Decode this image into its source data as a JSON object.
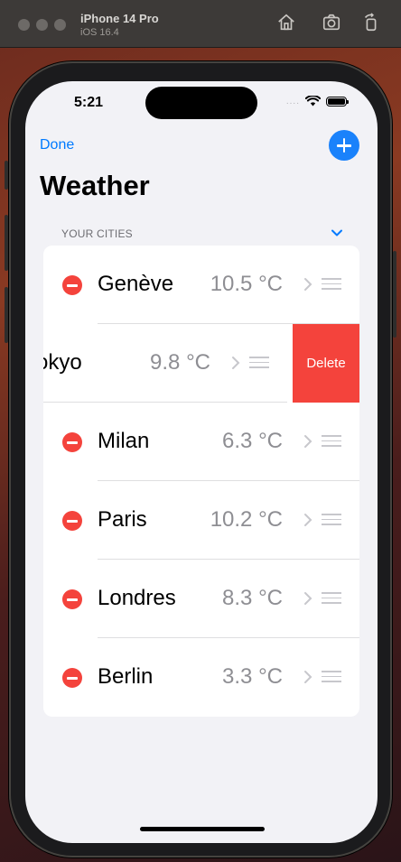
{
  "simulator": {
    "device_name": "iPhone 14 Pro",
    "os_version": "iOS 16.4",
    "buttons": [
      "home-icon",
      "screenshot-icon",
      "rotate-icon"
    ]
  },
  "status_bar": {
    "time": "5:21",
    "signal": "....",
    "icons": [
      "wifi-icon",
      "battery-icon"
    ]
  },
  "nav": {
    "done_label": "Done",
    "add_icon": "plus-circle-icon",
    "title": "Weather"
  },
  "section": {
    "header": "YOUR CITIES",
    "toggle_icon": "chevron-down-icon"
  },
  "cities": [
    {
      "name": "Genève",
      "temp": "10.5 °C",
      "state": "editing"
    },
    {
      "name": "Tokyo",
      "temp": "9.8 °C",
      "state": "swiped"
    },
    {
      "name": "Milan",
      "temp": "6.3 °C",
      "state": "editing"
    },
    {
      "name": "Paris",
      "temp": "10.2 °C",
      "state": "editing"
    },
    {
      "name": "Londres",
      "temp": "8.3 °C",
      "state": "editing"
    },
    {
      "name": "Berlin",
      "temp": "3.3 °C",
      "state": "editing"
    }
  ],
  "delete_action": {
    "label": "Delete"
  },
  "colors": {
    "accent": "#007aff",
    "destructive": "#f4433c",
    "background": "#f2f2f6"
  }
}
